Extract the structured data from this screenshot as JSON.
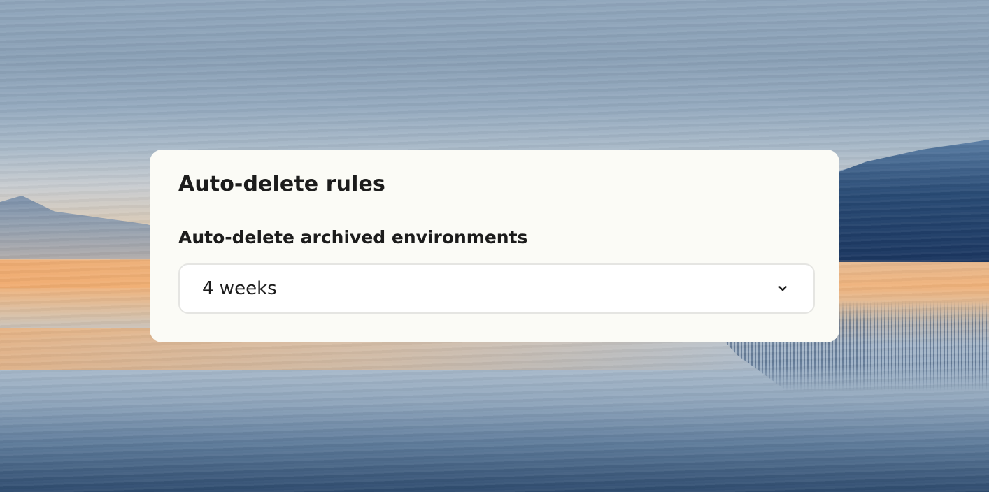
{
  "panel": {
    "title": "Auto-delete rules"
  },
  "archived_environments": {
    "label": "Auto-delete archived environments",
    "selected_value": "4 weeks",
    "dropdown_icon": "chevron-down-icon"
  },
  "colors": {
    "card_background": "#fbfbf6",
    "text": "#1c1c1c",
    "select_border": "#e5e5e2"
  }
}
